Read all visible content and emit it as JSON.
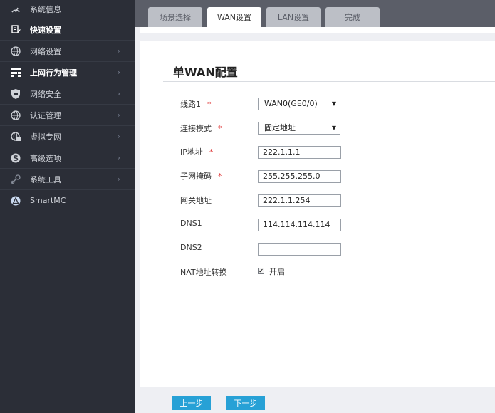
{
  "sidebar": {
    "items": [
      {
        "label": "系统信息",
        "icon": "speedometer-icon",
        "chevron": ""
      },
      {
        "label": "快速设置",
        "icon": "edit-icon",
        "chevron": ""
      },
      {
        "label": "网络设置",
        "icon": "globe-icon",
        "chevron": "›"
      },
      {
        "label": "上网行为管理",
        "icon": "grid-icon",
        "chevron": "›"
      },
      {
        "label": "网络安全",
        "icon": "shield-icon",
        "chevron": "›"
      },
      {
        "label": "认证管理",
        "icon": "globe-icon",
        "chevron": "›"
      },
      {
        "label": "虚拟专网",
        "icon": "globe-lock-icon",
        "chevron": "›"
      },
      {
        "label": "高级选项",
        "icon": "s-circle-icon",
        "chevron": "›"
      },
      {
        "label": "系统工具",
        "icon": "tools-icon",
        "chevron": "›"
      },
      {
        "label": "SmartMC",
        "icon": "triangle-circle-icon",
        "chevron": ""
      }
    ]
  },
  "tabs": [
    {
      "label": "场景选择"
    },
    {
      "label": "WAN设置"
    },
    {
      "label": "LAN设置"
    },
    {
      "label": "完成"
    }
  ],
  "form": {
    "title": "单WAN配置",
    "required_mark": "*",
    "line": {
      "label": "线路1",
      "value": "WAN0(GE0/0)"
    },
    "mode": {
      "label": "连接模式",
      "value": "固定地址"
    },
    "ip": {
      "label": "IP地址",
      "value": "222.1.1.1"
    },
    "mask": {
      "label": "子网掩码",
      "value": "255.255.255.0"
    },
    "gateway": {
      "label": "网关地址",
      "value": "222.1.1.254"
    },
    "dns1": {
      "label": "DNS1",
      "value": "114.114.114.114"
    },
    "dns2": {
      "label": "DNS2",
      "value": ""
    },
    "nat": {
      "label": "NAT地址转换",
      "checkbox_label": "开启",
      "checked_mark": "✔"
    }
  },
  "footer": {
    "prev_label": "上一步",
    "next_label": "下一步"
  },
  "colors": {
    "sidebar_bg": "#2b2e37",
    "accent": "#27a1d6",
    "required": "#e03c3c"
  }
}
